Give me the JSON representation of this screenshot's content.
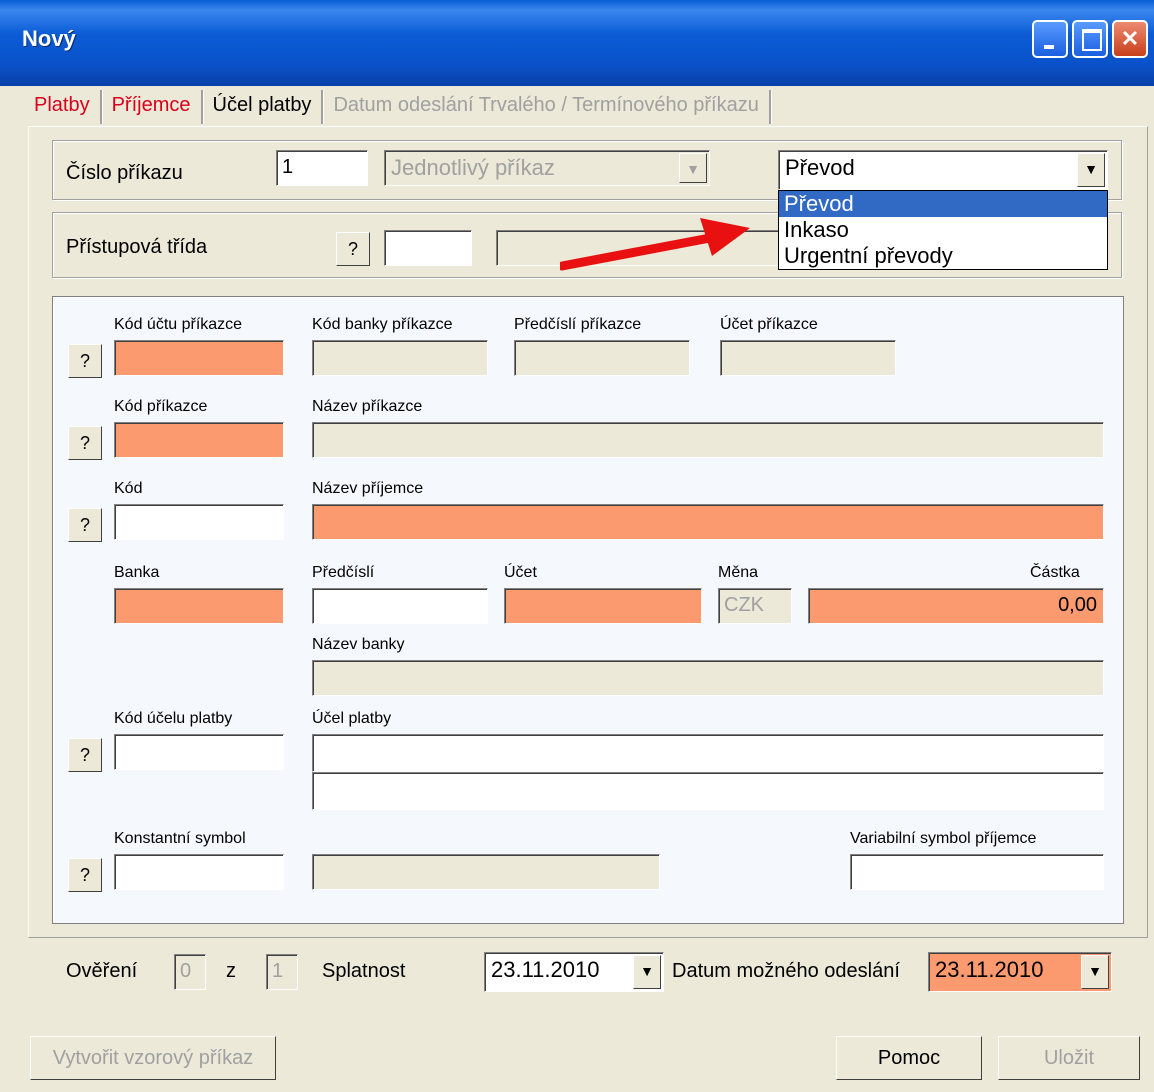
{
  "window": {
    "title": "Nový"
  },
  "tabs": [
    {
      "label": "Platby"
    },
    {
      "label": "Příjemce"
    },
    {
      "label": "Účel platby"
    },
    {
      "label": "Datum odeslání Trvalého / Termínového příkazu"
    }
  ],
  "header": {
    "cislo_label": "Číslo příkazu",
    "cislo_value": "1",
    "type_combo": "Jednotlivý příkaz",
    "transfer_combo": "Převod",
    "transfer_options": [
      "Převod",
      "Inkaso",
      "Urgentní převody"
    ],
    "pristupova_label": "Přístupová třída",
    "q": "?"
  },
  "form": {
    "kod_uctu_prikazce": "Kód účtu příkazce",
    "kod_banky_prikazce": "Kód banky příkazce",
    "predcisli_prikazce": "Předčíslí příkazce",
    "ucet_prikazce": "Účet příkazce",
    "kod_prikazce": "Kód příkazce",
    "nazev_prikazce": "Název příkazce",
    "kod": "Kód",
    "nazev_prijemce": "Název příjemce",
    "banka": "Banka",
    "predcisli": "Předčíslí",
    "ucet": "Účet",
    "mena": "Měna",
    "mena_value": "CZK",
    "castka": "Částka",
    "castka_value": "0,00",
    "nazev_banky": "Název banky",
    "kod_ucelu_platby": "Kód účelu platby",
    "ucel_platby": "Účel platby",
    "konstantni_symbol": "Konstantní symbol",
    "variabilni_symbol": "Variabilní symbol příjemce"
  },
  "footer": {
    "overeni_label": "Ověření",
    "overeni_value": "0",
    "z_label": "z",
    "z_value": "1",
    "splatnost_label": "Splatnost",
    "splatnost_value": "23.11.2010",
    "datum_label": "Datum možného odeslání",
    "datum_value": "23.11.2010"
  },
  "buttons": {
    "vytvorit": "Vytvořit vzorový příkaz",
    "pomoc": "Pomoc",
    "ulozit": "Uložit"
  },
  "colors": {
    "required_field": "#fa9a6e",
    "tab_active": "#d8001c",
    "annotation_arrow": "#e81010"
  }
}
